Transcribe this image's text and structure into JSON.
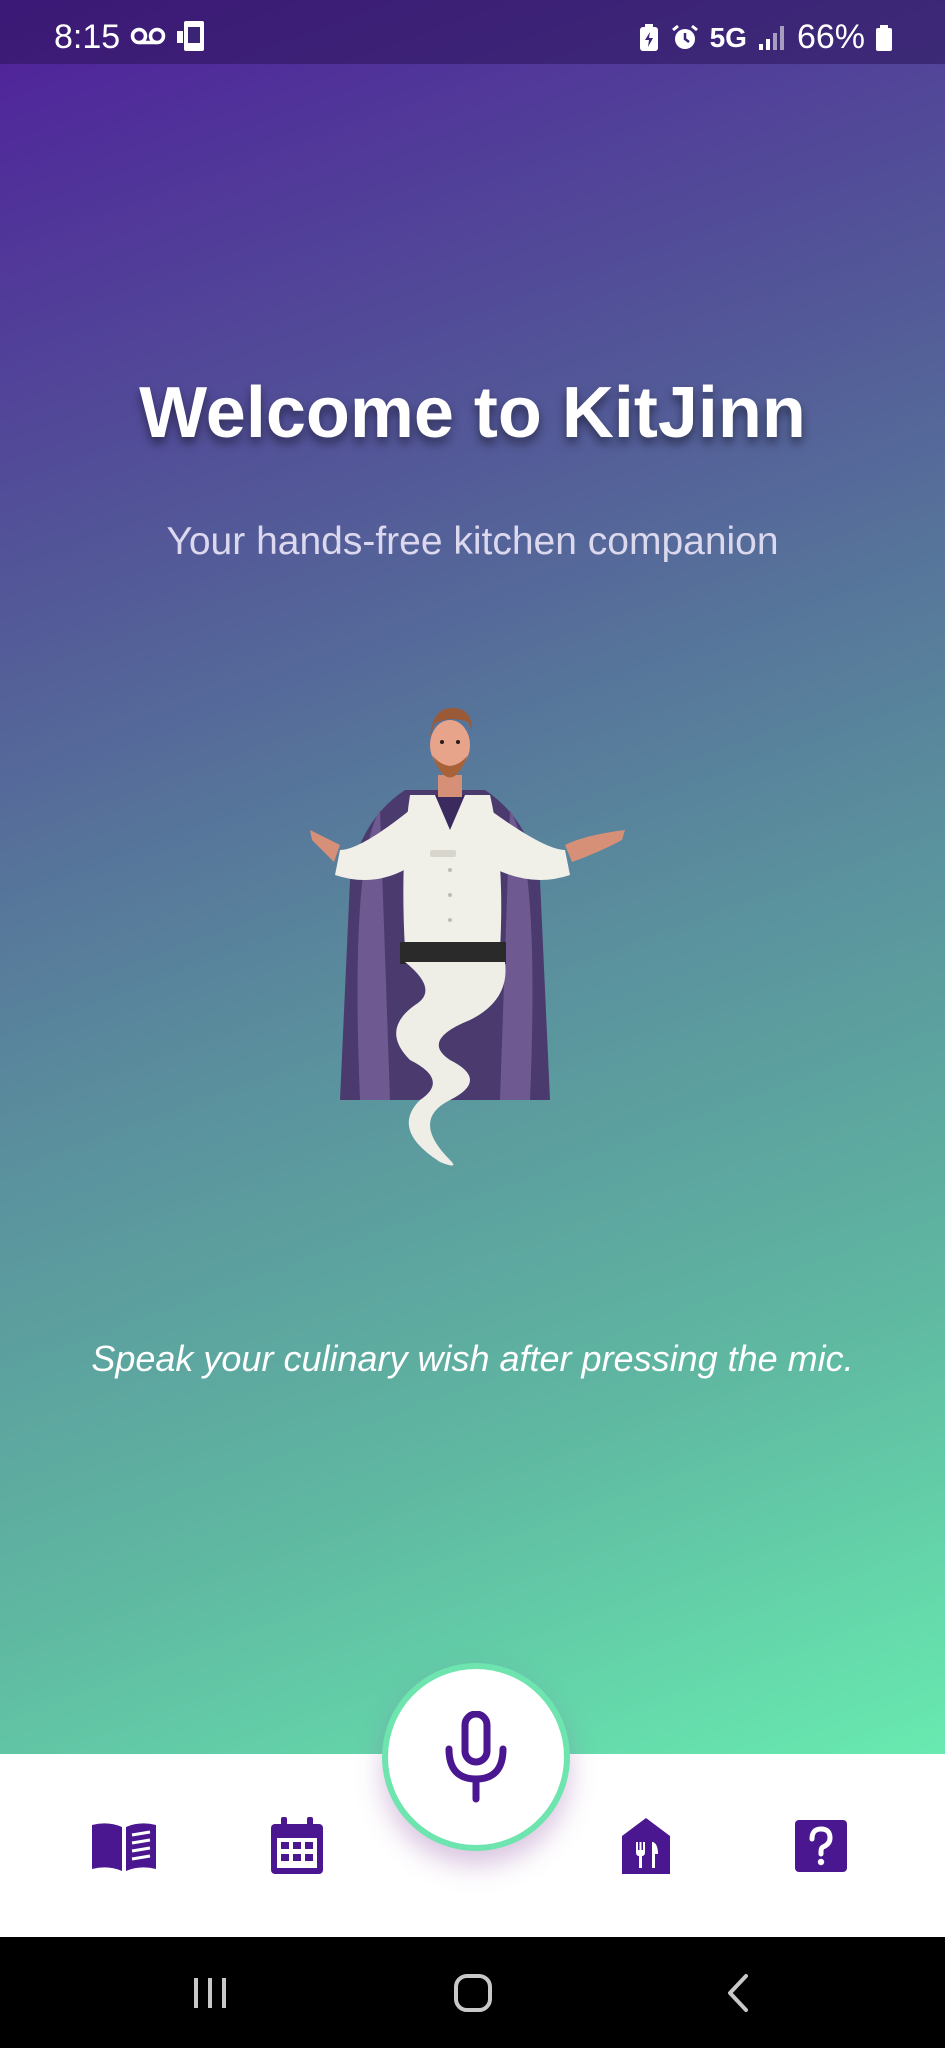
{
  "status_bar": {
    "time": "8:15",
    "network": "5G",
    "battery": "66%",
    "icons": [
      "voicemail-icon",
      "device-icon",
      "battery-saver-icon",
      "alarm-icon",
      "signal-icon",
      "battery-icon"
    ]
  },
  "main": {
    "title": "Welcome to KitJinn",
    "subtitle": "Your hands-free kitchen companion",
    "hint": "Speak your culinary wish after pressing the mic."
  },
  "bottom_nav": {
    "items": [
      {
        "name": "recipes",
        "icon": "open-book-icon"
      },
      {
        "name": "calendar",
        "icon": "calendar-icon"
      },
      {
        "name": "microphone",
        "icon": "microphone-icon"
      },
      {
        "name": "restaurant",
        "icon": "restaurant-icon"
      },
      {
        "name": "help",
        "icon": "help-icon"
      }
    ]
  },
  "colors": {
    "accent": "#4a1791",
    "mic_ring": "#6ee4ae",
    "gradient_top": "#4f1f9a",
    "gradient_bottom": "#68eab0"
  }
}
